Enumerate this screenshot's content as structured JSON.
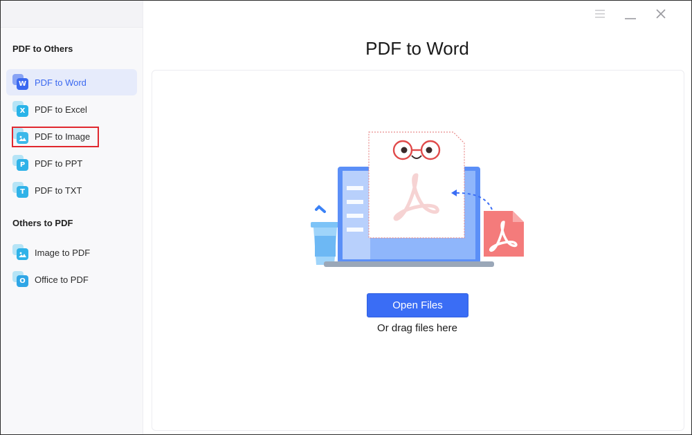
{
  "window": {
    "controls": [
      {
        "name": "menu-icon"
      },
      {
        "name": "minimize-icon"
      },
      {
        "name": "close-icon"
      }
    ]
  },
  "sidebar": {
    "section_pdf_to_others": "PDF to Others",
    "section_others_to_pdf": "Others to PDF",
    "items": [
      {
        "label": "PDF to Word",
        "glyph": "W",
        "color": "#3a68f0",
        "active": true,
        "icon": "word-icon"
      },
      {
        "label": "PDF to Excel",
        "glyph": "X",
        "color": "#29b3e8",
        "active": false,
        "icon": "excel-icon"
      },
      {
        "label": "PDF to Image",
        "glyph": "",
        "color": "#3bb8ea",
        "active": false,
        "icon": "image-icon"
      },
      {
        "label": "PDF to PPT",
        "glyph": "P",
        "color": "#2fb2e8",
        "active": false,
        "icon": "ppt-icon"
      },
      {
        "label": "PDF to TXT",
        "glyph": "T",
        "color": "#2fb2e8",
        "active": false,
        "icon": "txt-icon"
      },
      {
        "label": "Image to PDF",
        "glyph": "",
        "color": "#2fb2e8",
        "active": false,
        "icon": "image-to-pdf-icon"
      },
      {
        "label": "Office to PDF",
        "glyph": "O",
        "color": "#2fa6e6",
        "active": false,
        "icon": "office-icon"
      }
    ]
  },
  "main": {
    "title": "PDF to Word",
    "open_button": "Open Files",
    "drag_hint": "Or drag files here"
  },
  "colors": {
    "accent": "#3a6df5",
    "highlight_box": "#e0272e",
    "pdf_red": "#f47b7b"
  }
}
